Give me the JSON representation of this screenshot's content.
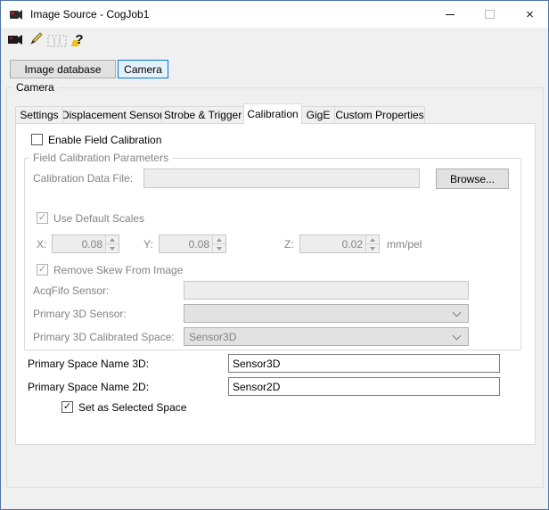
{
  "window": {
    "title": "Image Source - CogJob1"
  },
  "glyphs": {
    "check": "✓",
    "close": "×",
    "help": "?"
  },
  "toolbar": {
    "icons": [
      "acquire-image-icon",
      "edit-acquisition-icon",
      "image-order-icon",
      "help-icon"
    ]
  },
  "source_selector": {
    "image_database_label": "Image database",
    "camera_label": "Camera"
  },
  "camera_group_label": "Camera",
  "tabs": [
    {
      "label": "Settings",
      "selected": false
    },
    {
      "label": "Displacement Sensor",
      "selected": false
    },
    {
      "label": "Strobe & Trigger",
      "selected": false
    },
    {
      "label": "Calibration",
      "selected": true
    },
    {
      "label": "GigE",
      "selected": false
    },
    {
      "label": "Custom Properties",
      "selected": false
    }
  ],
  "calibration_tab": {
    "enable_field_calibration_label": "Enable Field Calibration",
    "field_calibration_parameters": {
      "group_label": "Field Calibration Parameters",
      "calibration_data_file_label": "Calibration Data File:",
      "calibration_data_file_value": "",
      "browse_button_label": "Browse...",
      "use_default_scales_label": "Use Default Scales",
      "x_label": "X:",
      "x_value": "0.08",
      "y_label": "Y:",
      "y_value": "0.08",
      "z_label": "Z:",
      "z_value": "0.02",
      "scale_unit": "mm/pel",
      "remove_skew_label": "Remove Skew From Image",
      "acqfifo_sensor_label": "AcqFifo Sensor:",
      "acqfifo_sensor_value": "",
      "primary_3d_sensor_label": "Primary 3D Sensor:",
      "primary_3d_sensor_value": "",
      "primary_3d_calibrated_space_label": "Primary 3D Calibrated Space:",
      "primary_3d_calibrated_space_value": "Sensor3D"
    },
    "primary_space_name_3d_label": "Primary Space Name 3D:",
    "primary_space_name_3d_value": "Sensor3D",
    "primary_space_name_2d_label": "Primary Space Name 2D:",
    "primary_space_name_2d_value": "Sensor2D",
    "set_as_selected_space_label": "Set as Selected Space"
  },
  "colors": {
    "accent": "#0078d7",
    "selected_button_bg": "#e5f1fb",
    "disabled_text": "#838383",
    "dialog_bg": "#f0f0f0"
  }
}
